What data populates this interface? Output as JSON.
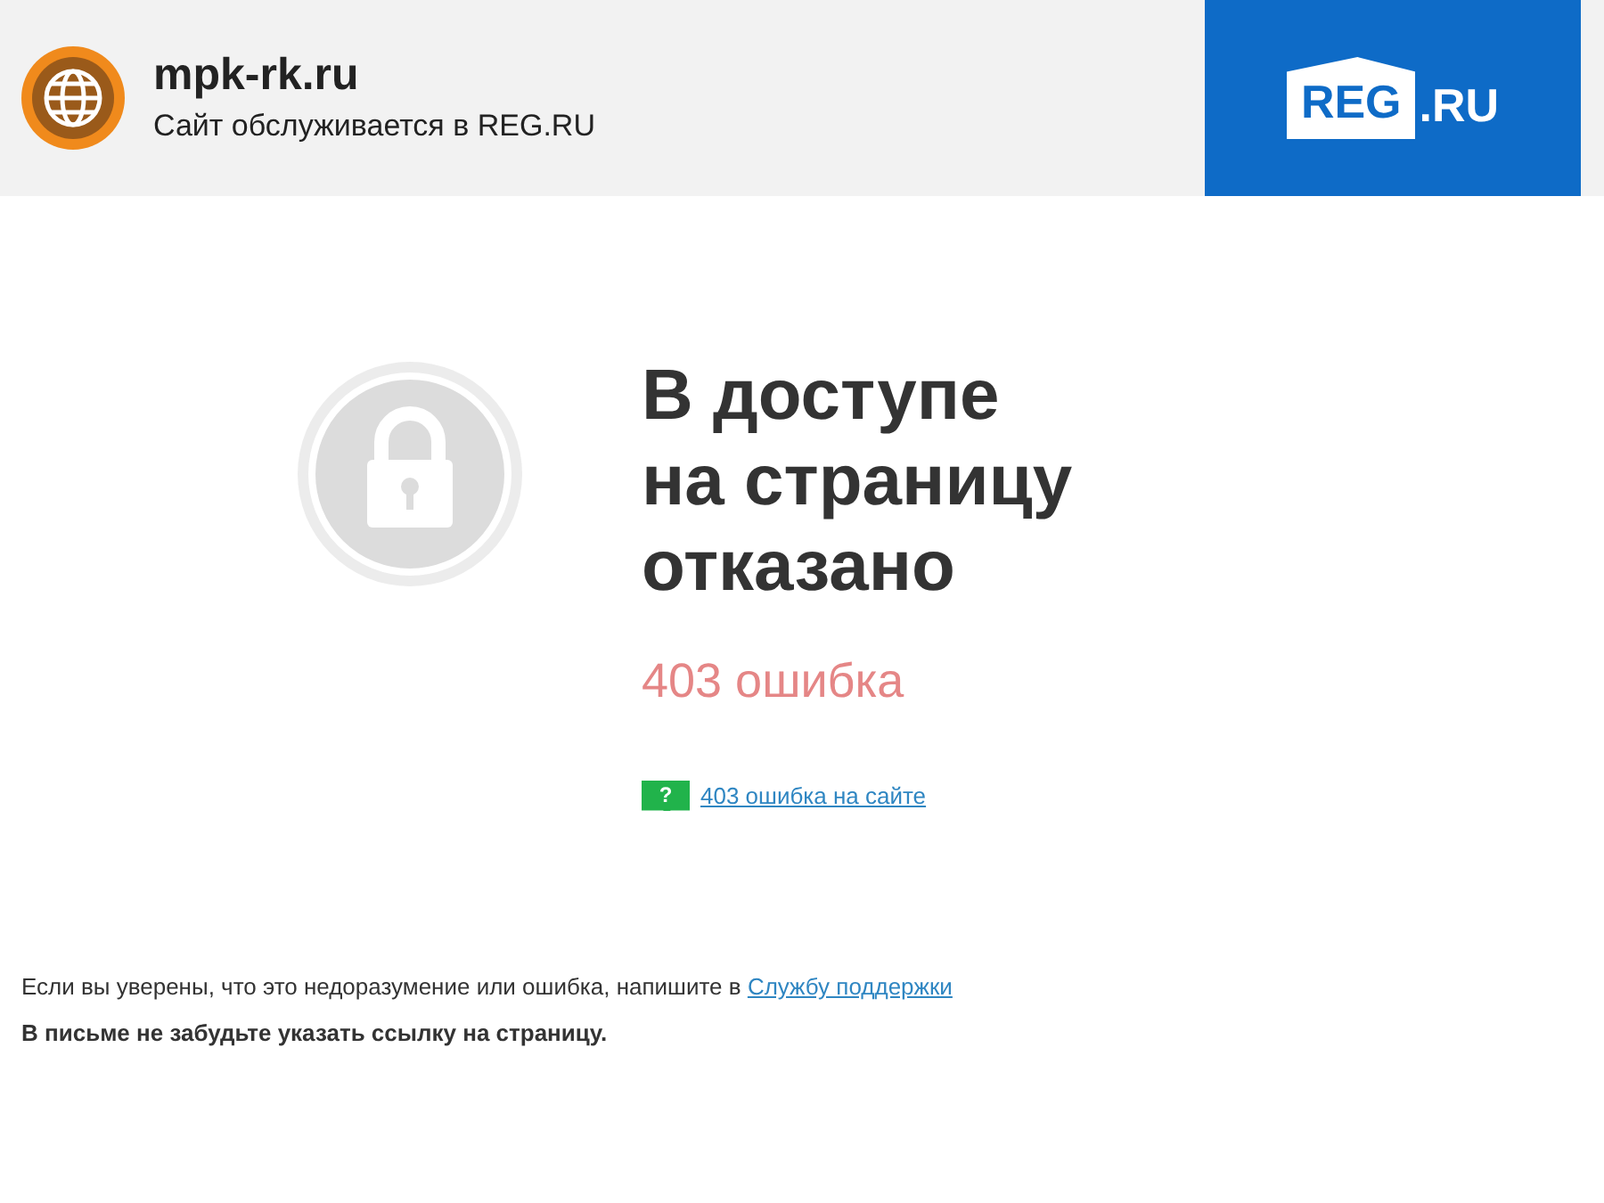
{
  "header": {
    "site": "mpk-rk.ru",
    "subtitle": "Сайт обслуживается в REG.RU",
    "logo_main": "REG",
    "logo_suffix": ".RU"
  },
  "error": {
    "title_lines": [
      "В доступе",
      "на страницу",
      "отказано"
    ],
    "code": "403 ошибка",
    "help_badge": "?",
    "help_link": "403 ошибка на сайте"
  },
  "footer": {
    "text": "Если вы уверены, что это недоразумение или ошибка, напишите в",
    "link": "Службу поддержки",
    "note": "В письме не забудьте указать ссылку на страницу."
  }
}
